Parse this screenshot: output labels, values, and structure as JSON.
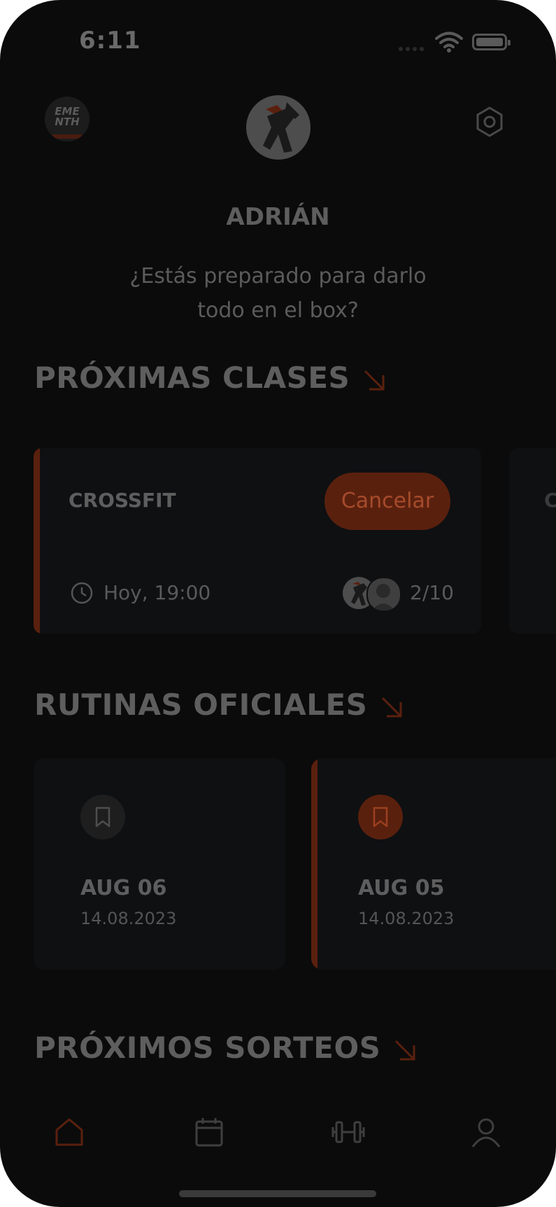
{
  "status_bar": {
    "time": "6:11"
  },
  "header": {
    "brand_logo_text": "EME NTH",
    "username": "ADRIÁN",
    "greeting": "¿Estás preparado para darlo todo en el box?"
  },
  "sections": {
    "upcoming_classes": "PRÓXIMAS CLASES",
    "official_routines": "RUTINAS OFICIALES",
    "upcoming_draws": "PRÓXIMOS SORTEOS"
  },
  "class_card": {
    "name": "CROSSFIT",
    "cancel_label": "Cancelar",
    "time": "Hoy, 19:00",
    "attendance": "2/10",
    "next_card_peek": "C"
  },
  "routines": [
    {
      "title": "AUG 06",
      "date": "14.08.2023",
      "highlighted": false
    },
    {
      "title": "AUG 05",
      "date": "14.08.2023",
      "highlighted": true
    }
  ],
  "nav": {
    "items": [
      "home-icon",
      "calendar-icon",
      "dumbbell-icon",
      "user-icon"
    ],
    "active": "home-icon"
  },
  "colors": {
    "background": "#0b0b0b",
    "card": "#0f1012",
    "accent": "#5a200e",
    "text": "#5e5e5e"
  }
}
